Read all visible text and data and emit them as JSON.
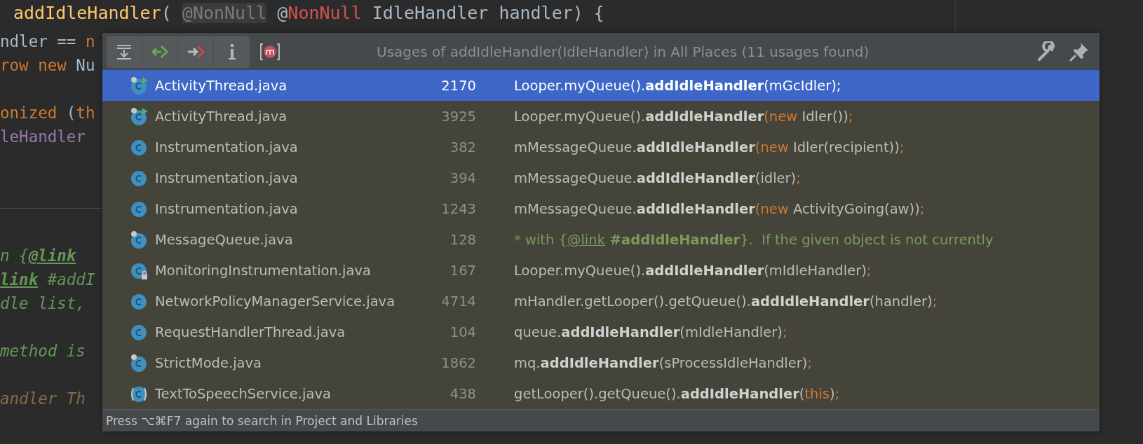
{
  "editor": {
    "lines": [
      {
        "kind": "signature",
        "segments": [
          {
            "kind": "method",
            "text": "addIdleHandler"
          },
          {
            "kind": "plain",
            "text": "( "
          },
          {
            "kind": "hint",
            "text": "@NonNull"
          },
          {
            "kind": "plain",
            "text": " @"
          },
          {
            "kind": "error",
            "text": "NonNull"
          },
          {
            "kind": "plain",
            "text": " IdleHandler handler) {"
          }
        ]
      },
      {
        "kind": "code",
        "segments": [
          {
            "kind": "plain",
            "text": "ndler == "
          },
          {
            "kind": "keyword",
            "text": "n"
          }
        ]
      },
      {
        "kind": "code",
        "segments": [
          {
            "kind": "keyword",
            "text": "row new"
          },
          {
            "kind": "plain",
            "text": " Nu"
          }
        ]
      },
      {
        "kind": "blank"
      },
      {
        "kind": "code",
        "segments": [
          {
            "kind": "keyword",
            "text": "onized"
          },
          {
            "kind": "plain",
            "text": " ("
          },
          {
            "kind": "keyword",
            "text": "th"
          }
        ]
      },
      {
        "kind": "code",
        "segments": [
          {
            "kind": "field",
            "text": "leHandler"
          }
        ]
      },
      {
        "kind": "blank"
      },
      {
        "kind": "blank"
      },
      {
        "kind": "separator"
      },
      {
        "kind": "blank"
      },
      {
        "kind": "code",
        "segments": [
          {
            "kind": "doc",
            "text": "n {"
          },
          {
            "kind": "doc-tag",
            "text": "@link"
          }
        ]
      },
      {
        "kind": "code",
        "segments": [
          {
            "kind": "doc-tag",
            "text": "link"
          },
          {
            "kind": "doc",
            "text": " #addI"
          }
        ]
      },
      {
        "kind": "code",
        "segments": [
          {
            "kind": "doc",
            "text": "dle list,"
          }
        ]
      },
      {
        "kind": "blank"
      },
      {
        "kind": "code",
        "segments": [
          {
            "kind": "doc",
            "text": "method is"
          }
        ]
      },
      {
        "kind": "blank"
      },
      {
        "kind": "code",
        "segments": [
          {
            "kind": "doc-param",
            "text": "andler Th"
          }
        ]
      }
    ]
  },
  "usages_popup": {
    "title": "Usages of addIdleHandler(IdleHandler) in All Places (11 usages found)",
    "rows": [
      {
        "kind": "runnable",
        "file": "ActivityThread.java",
        "line": "2170",
        "selected": true,
        "code": [
          {
            "kind": "plain",
            "text": "Looper.myQueue()."
          },
          {
            "kind": "bold",
            "text": "addIdleHandler"
          },
          {
            "kind": "plain",
            "text": "(mGcIdler);"
          }
        ]
      },
      {
        "kind": "runnable",
        "file": "ActivityThread.java",
        "line": "3925",
        "selected": false,
        "code": [
          {
            "kind": "plain",
            "text": "Looper.myQueue()."
          },
          {
            "kind": "bold",
            "text": "addIdleHandler"
          },
          {
            "kind": "keyword",
            "text": "(new "
          },
          {
            "kind": "plain",
            "text": "Idler())"
          },
          {
            "kind": "keyword",
            "text": ";"
          }
        ]
      },
      {
        "kind": "plain",
        "file": "Instrumentation.java",
        "line": "382",
        "selected": false,
        "code": [
          {
            "kind": "plain",
            "text": "mMessageQueue."
          },
          {
            "kind": "bold",
            "text": "addIdleHandler"
          },
          {
            "kind": "keyword",
            "text": "(new "
          },
          {
            "kind": "plain",
            "text": "Idler(recipient))"
          },
          {
            "kind": "keyword",
            "text": ";"
          }
        ]
      },
      {
        "kind": "plain",
        "file": "Instrumentation.java",
        "line": "394",
        "selected": false,
        "code": [
          {
            "kind": "plain",
            "text": "mMessageQueue."
          },
          {
            "kind": "bold",
            "text": "addIdleHandler"
          },
          {
            "kind": "plain",
            "text": "(idler)"
          },
          {
            "kind": "keyword",
            "text": ";"
          }
        ]
      },
      {
        "kind": "plain",
        "file": "Instrumentation.java",
        "line": "1243",
        "selected": false,
        "code": [
          {
            "kind": "plain",
            "text": "mMessageQueue."
          },
          {
            "kind": "bold",
            "text": "addIdleHandler"
          },
          {
            "kind": "keyword",
            "text": "(new "
          },
          {
            "kind": "plain",
            "text": "ActivityGoing(aw))"
          },
          {
            "kind": "keyword",
            "text": ";"
          }
        ]
      },
      {
        "kind": "marked",
        "file": "MessageQueue.java",
        "line": "128",
        "selected": false,
        "code": [
          {
            "kind": "comment",
            "text": "* with {"
          },
          {
            "kind": "comment-link",
            "text": "@link"
          },
          {
            "kind": "comment-bold",
            "text": " #addIdleHandler"
          },
          {
            "kind": "comment",
            "text": "}.  If the given object is not currently"
          }
        ]
      },
      {
        "kind": "locked",
        "file": "MonitoringInstrumentation.java",
        "line": "167",
        "selected": false,
        "code": [
          {
            "kind": "plain",
            "text": "Looper.myQueue()."
          },
          {
            "kind": "bold",
            "text": "addIdleHandler"
          },
          {
            "kind": "plain",
            "text": "(mIdleHandler)"
          },
          {
            "kind": "keyword",
            "text": ";"
          }
        ]
      },
      {
        "kind": "plain",
        "file": "NetworkPolicyManagerService.java",
        "line": "4714",
        "selected": false,
        "code": [
          {
            "kind": "plain",
            "text": "mHandler.getLooper().getQueue()."
          },
          {
            "kind": "bold",
            "text": "addIdleHandler"
          },
          {
            "kind": "plain",
            "text": "(handler)"
          },
          {
            "kind": "keyword",
            "text": ";"
          }
        ]
      },
      {
        "kind": "plain",
        "file": "RequestHandlerThread.java",
        "line": "104",
        "selected": false,
        "code": [
          {
            "kind": "plain",
            "text": "queue."
          },
          {
            "kind": "bold",
            "text": "addIdleHandler"
          },
          {
            "kind": "plain",
            "text": "(mIdleHandler)"
          },
          {
            "kind": "keyword",
            "text": ";"
          }
        ]
      },
      {
        "kind": "marked",
        "file": "StrictMode.java",
        "line": "1862",
        "selected": false,
        "code": [
          {
            "kind": "plain",
            "text": "mq."
          },
          {
            "kind": "bold",
            "text": "addIdleHandler"
          },
          {
            "kind": "plain",
            "text": "(sProcessIdleHandler)"
          },
          {
            "kind": "keyword",
            "text": ";"
          }
        ]
      },
      {
        "kind": "abstract",
        "file": "TextToSpeechService.java",
        "line": "438",
        "selected": false,
        "code": [
          {
            "kind": "plain",
            "text": "getLooper().getQueue()."
          },
          {
            "kind": "bold",
            "text": "addIdleHandler"
          },
          {
            "kind": "plain",
            "text": "("
          },
          {
            "kind": "keyword",
            "text": "this"
          },
          {
            "kind": "plain",
            "text": ")"
          },
          {
            "kind": "keyword",
            "text": ";"
          }
        ]
      }
    ],
    "footer": "Press ⌥⌘F7 again to search in Project and Libraries"
  }
}
